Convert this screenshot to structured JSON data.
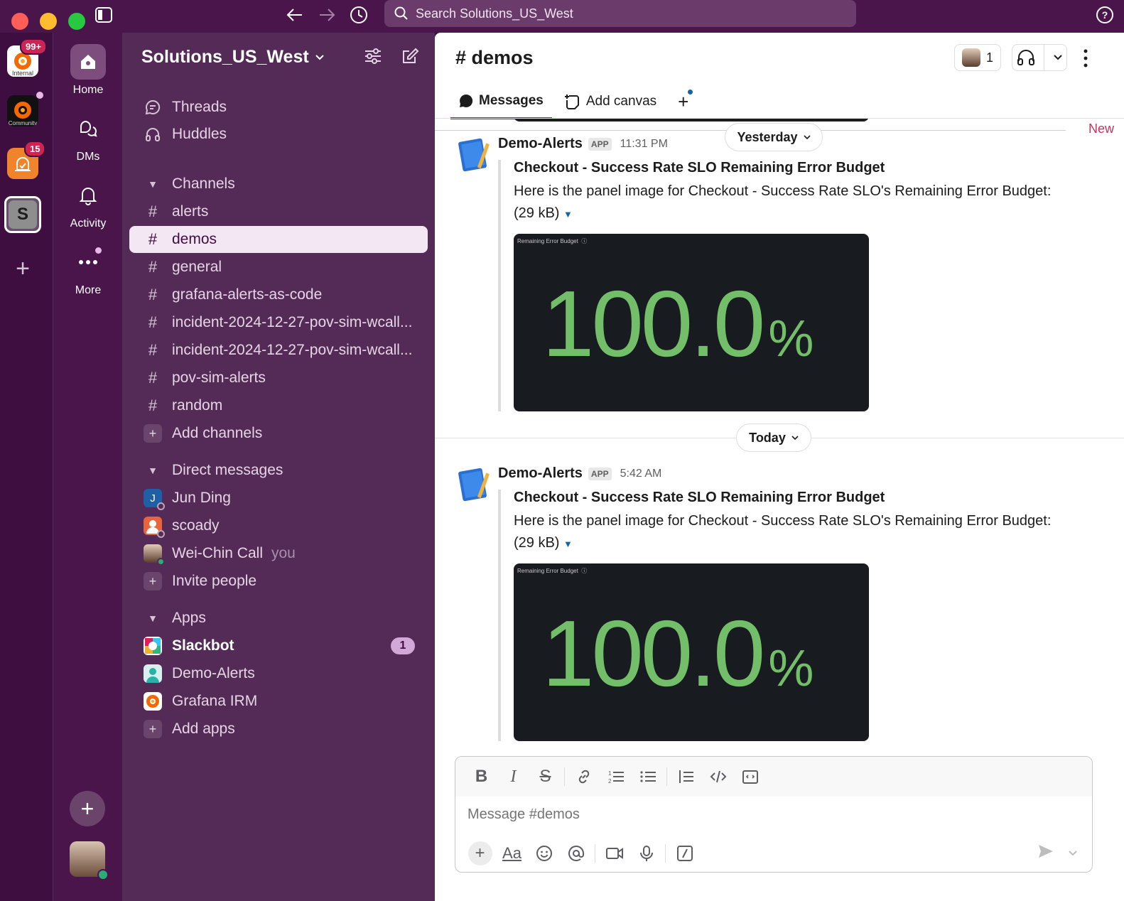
{
  "search": {
    "placeholder": "Search Solutions_US_West"
  },
  "rail": {
    "workspaces": [
      {
        "label": "Internal",
        "badge": "99+"
      },
      {
        "label": "Community",
        "dot": true
      },
      {
        "label": "",
        "badge": "15"
      },
      {
        "label": "S"
      }
    ]
  },
  "nav": {
    "home": "Home",
    "dms": "DMs",
    "activity": "Activity",
    "more": "More"
  },
  "sidebar": {
    "workspace_name": "Solutions_US_West",
    "threads": "Threads",
    "huddles": "Huddles",
    "channels_header": "Channels",
    "channels": [
      "alerts",
      "demos",
      "general",
      "grafana-alerts-as-code",
      "incident-2024-12-27-pov-sim-wcall...",
      "incident-2024-12-27-pov-sim-wcall...",
      "pov-sim-alerts",
      "random"
    ],
    "add_channels": "Add channels",
    "dms_header": "Direct messages",
    "dms": [
      {
        "name": "Jun Ding",
        "initial": "J"
      },
      {
        "name": "scoady"
      },
      {
        "name": "Wei-Chin Call",
        "suffix": "you"
      }
    ],
    "invite": "Invite people",
    "apps_header": "Apps",
    "apps": [
      {
        "name": "Slackbot",
        "count": "1"
      },
      {
        "name": "Demo-Alerts"
      },
      {
        "name": "Grafana IRM"
      }
    ],
    "add_apps": "Add apps"
  },
  "channel": {
    "title": "# demos",
    "member_count": "1",
    "tabs": {
      "messages": "Messages",
      "add_canvas": "Add canvas"
    },
    "new_label": "New",
    "days": {
      "yesterday": "Yesterday",
      "today": "Today"
    },
    "messages": [
      {
        "sender": "Demo-Alerts",
        "tag": "APP",
        "time": "11:31 PM",
        "title": "Checkout - Success Rate SLO Remaining Error Budget",
        "text": "Here is the panel image for Checkout - Success Rate SLO's Remaining Error Budget:",
        "size": "(29 kB)",
        "panel_title": "Remaining Error Budget",
        "panel_value": "100.0",
        "panel_unit": "%"
      },
      {
        "sender": "Demo-Alerts",
        "tag": "APP",
        "time": "5:42 AM",
        "title": "Checkout - Success Rate SLO Remaining Error Budget",
        "text": "Here is the panel image for Checkout - Success Rate SLO's Remaining Error Budget:",
        "size": "(29 kB)",
        "panel_title": "Remaining Error Budget",
        "panel_value": "100.0",
        "panel_unit": "%"
      }
    ]
  },
  "composer": {
    "placeholder": "Message #demos",
    "format_label": "Aa"
  },
  "colors": {
    "aubergine": "#4a154b",
    "sidebar": "#542b56",
    "active_row": "#f4e7f4",
    "badge_red": "#cd2553",
    "new_red": "#d0315b",
    "panel_green": "#73bf69"
  }
}
